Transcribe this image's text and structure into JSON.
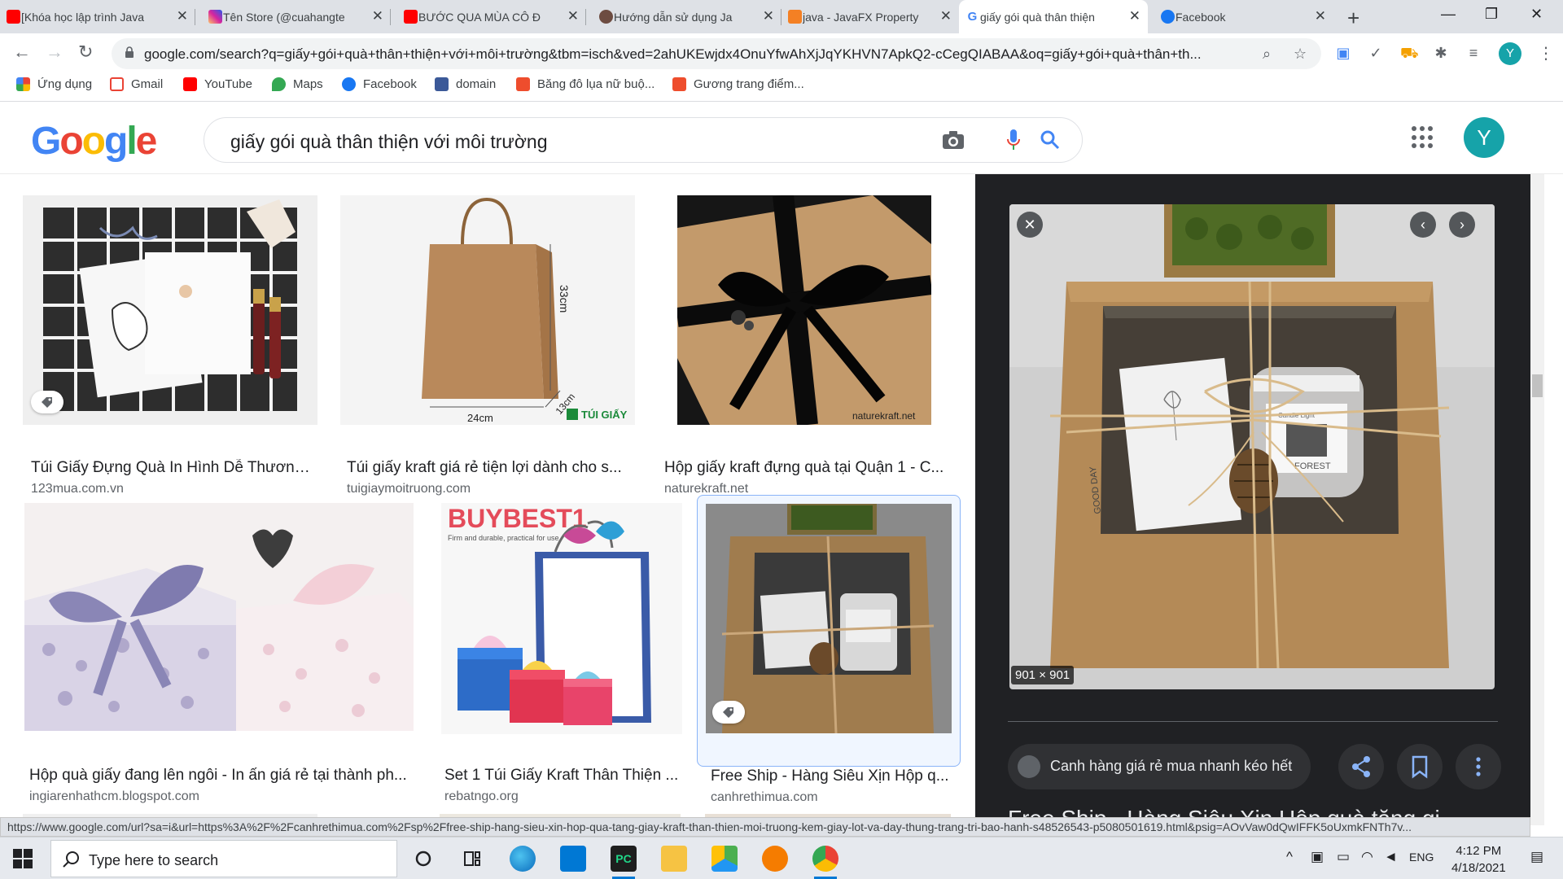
{
  "browser": {
    "tabs": [
      {
        "label": "[Khóa học lập trình Java",
        "favicon": "youtube",
        "color": "#ff0000"
      },
      {
        "label": "Tên Store (@cuahangte",
        "favicon": "instagram",
        "color": "#d6249f"
      },
      {
        "label": "BƯỚC QUA MÙA CÔ Đ",
        "favicon": "youtube",
        "color": "#ff0000"
      },
      {
        "label": "Hướng dẫn sử dụng Ja",
        "favicon": "avatar",
        "color": "#6d4c41"
      },
      {
        "label": "java - JavaFX Property",
        "favicon": "stackoverflow",
        "color": "#f48024"
      },
      {
        "label": "giấy gói quà thân thiện",
        "favicon": "google",
        "color": "#4285f4",
        "active": true
      },
      {
        "label": "Facebook",
        "favicon": "facebook",
        "color": "#1877f2"
      }
    ],
    "url": "google.com/search?q=giấy+gói+quà+thân+thiện+với+môi+trường&tbm=isch&ved=2ahUKEwjdx4OnuYfwAhXjJqYKHVN7ApkQ2-cCegQIABAA&oq=giấy+gói+quà+thân+th...",
    "profile_initial": "Y",
    "bookmarks": [
      {
        "label": "Ứng dụng",
        "icon": "apps-icon",
        "color": "#ea4335"
      },
      {
        "label": "Gmail",
        "icon": "gmail-icon",
        "color": "#ea4335"
      },
      {
        "label": "YouTube",
        "icon": "youtube-icon",
        "color": "#ff0000"
      },
      {
        "label": "Maps",
        "icon": "maps-icon",
        "color": "#34a853"
      },
      {
        "label": "Facebook",
        "icon": "facebook-icon",
        "color": "#1877f2"
      },
      {
        "label": "domain",
        "icon": "domain-icon",
        "color": "#3b5998"
      },
      {
        "label": "Băng đô lụa nữ buộ...",
        "icon": "shop-icon",
        "color": "#ee4d2d"
      },
      {
        "label": "Gương trang điểm...",
        "icon": "shop-icon",
        "color": "#ee4d2d"
      }
    ]
  },
  "google": {
    "logo": [
      "G",
      "o",
      "o",
      "g",
      "l",
      "e"
    ],
    "query": "giấy gói quà thân thiện với môi trường",
    "avatar_initial": "Y"
  },
  "results": [
    {
      "title": "Túi Giấy Đựng Quà In Hình Dễ Thương ...",
      "source": "123mua.com.vn",
      "tag": true
    },
    {
      "title": "Túi giấy kraft giá rẻ tiện lợi dành cho s...",
      "source": "tuigiaymoitruong.com",
      "overlay": "33cm",
      "overlay2": "24cm",
      "overlay3": "13cm",
      "overlay4": "TÚI GIẤY"
    },
    {
      "title": "Hộp giấy kraft đựng quà tại Quận 1 - C...",
      "source": "naturekraft.net",
      "overlay": "naturekraft.net"
    },
    {
      "title": "Hộp quà giấy đang lên ngôi - In ấn giá rẻ tại thành ph...",
      "source": "ingiarenhathcm.blogspot.com"
    },
    {
      "title": "Set 1 Túi Giấy Kraft Thân Thiện ...",
      "source": "rebatngo.org",
      "overlay": "BUYBEST1",
      "overlay2": "Firm and durable, practical for use"
    },
    {
      "title": "Free Ship - Hàng Siêu Xịn Hộp q...",
      "source": "canhrethimua.com",
      "tag": true,
      "selected": true
    }
  ],
  "panel": {
    "dimensions": "901 × 901",
    "visit_label": "Canh hàng giá rẻ mua nhanh kéo hết",
    "title": "Free Ship - Hàng Siêu Xịn Hộp quà tặng gi",
    "image_texts": [
      "GOOD DAY",
      "Candle Light",
      "FOREST"
    ]
  },
  "status_url": "https://www.google.com/url?sa=i&url=https%3A%2F%2Fcanhrethimua.com%2Fsp%2Ffree-ship-hang-sieu-xin-hop-qua-tang-giay-kraft-than-thien-moi-truong-kem-giay-lot-va-day-thung-trang-tri-bao-hanh-s48526543-p5080501619.html&psig=AOvVaw0dQwIFFK5oUxmkFNTh7v...",
  "taskbar": {
    "search_placeholder": "Type here to search",
    "language": "ENG",
    "time": "4:12 PM",
    "date": "4/18/2021"
  }
}
